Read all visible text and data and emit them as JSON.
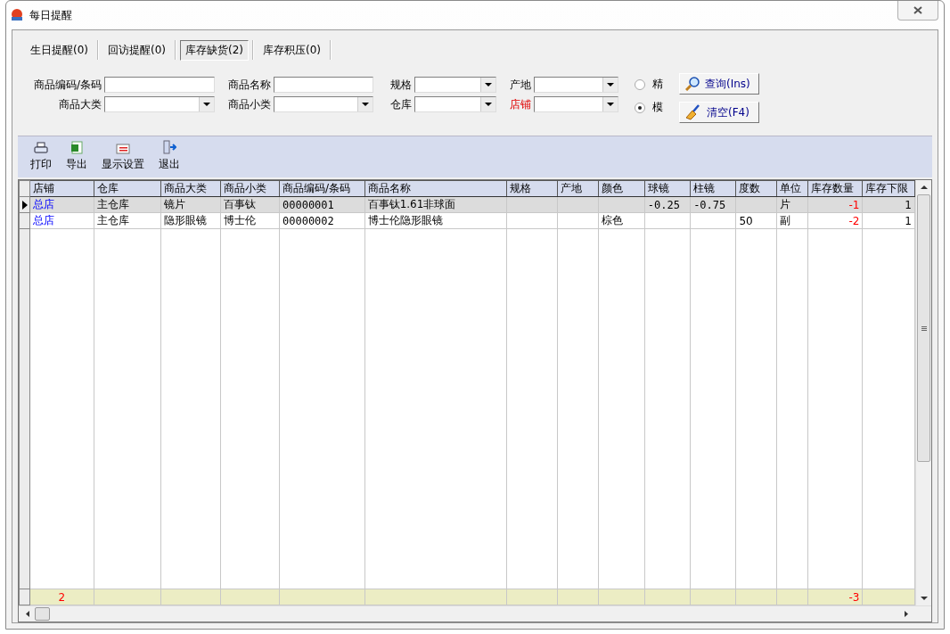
{
  "window": {
    "title": "每日提醒"
  },
  "tabs": [
    {
      "label": "生日提醒(0)",
      "selected": false
    },
    {
      "label": "回访提醒(0)",
      "selected": false
    },
    {
      "label": "库存缺货(2)",
      "selected": true
    },
    {
      "label": "库存积压(0)",
      "selected": false
    }
  ],
  "filters": [
    {
      "label": "商品编码/条码",
      "kind": "text",
      "highlighted": false
    },
    {
      "label": "商品名称",
      "kind": "text",
      "highlighted": false
    },
    {
      "label": "规格",
      "kind": "select",
      "highlighted": false
    },
    {
      "label": "产地",
      "kind": "select",
      "highlighted": false
    },
    {
      "label": "商品大类",
      "kind": "select",
      "highlighted": false
    },
    {
      "label": "商品小类",
      "kind": "select",
      "highlighted": false
    },
    {
      "label": "仓库",
      "kind": "select",
      "highlighted": false
    },
    {
      "label": "店铺",
      "kind": "select",
      "highlighted": true
    }
  ],
  "match_modes": [
    {
      "label": "精",
      "selected": false
    },
    {
      "label": "模",
      "selected": true
    }
  ],
  "actions": [
    {
      "label": "查询(Ins)",
      "kind": "search"
    },
    {
      "label": "清空(F4)",
      "kind": "clear"
    }
  ],
  "toolbar": [
    {
      "label": "打印",
      "kind": "print"
    },
    {
      "label": "导出",
      "kind": "export"
    },
    {
      "label": "显示设置",
      "kind": "settings"
    },
    {
      "label": "退出",
      "kind": "exit"
    }
  ],
  "table": {
    "columns": [
      {
        "label": "店铺",
        "kind": "link"
      },
      {
        "label": "仓库",
        "kind": "text"
      },
      {
        "label": "商品大类",
        "kind": "text"
      },
      {
        "label": "商品小类",
        "kind": "text"
      },
      {
        "label": "商品编码/条码",
        "kind": "text"
      },
      {
        "label": "商品名称",
        "kind": "text"
      },
      {
        "label": "规格",
        "kind": "text"
      },
      {
        "label": "产地",
        "kind": "text"
      },
      {
        "label": "颜色",
        "kind": "text"
      },
      {
        "label": "球镜",
        "kind": "text"
      },
      {
        "label": "柱镜",
        "kind": "text"
      },
      {
        "label": "度数",
        "kind": "text"
      },
      {
        "label": "单位",
        "kind": "text"
      },
      {
        "label": "库存数量",
        "kind": "alert"
      },
      {
        "label": "库存下限",
        "kind": "number"
      }
    ],
    "rows": [
      {
        "selected": true,
        "cells": [
          "总店",
          "主仓库",
          "镜片",
          "百事钛",
          "00000001",
          "百事钛1.61非球面",
          "",
          "",
          "",
          "-0.25",
          "-0.75",
          "",
          "片",
          "-1",
          "1"
        ]
      },
      {
        "selected": false,
        "cells": [
          "总店",
          "主仓库",
          "隐形眼镜",
          "博士伦",
          "00000002",
          "博士伦隐形眼镜",
          "",
          "",
          "棕色",
          "",
          "",
          "50",
          "副",
          "-2",
          "1"
        ]
      }
    ],
    "footer": {
      "count": "2",
      "total": "-3"
    }
  }
}
